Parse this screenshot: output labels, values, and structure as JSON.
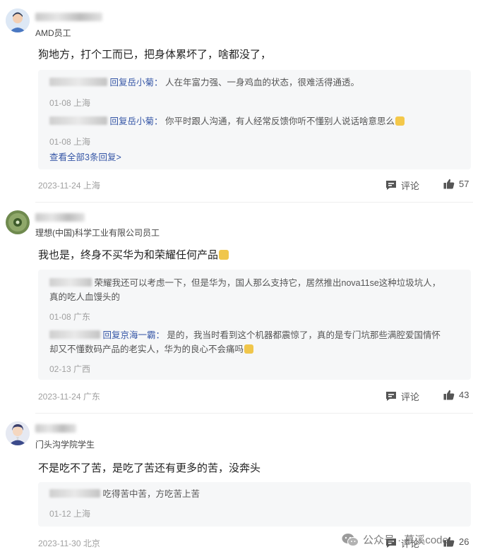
{
  "comments": [
    {
      "user_title": "AMD员工",
      "content": "狗地方，打个工而已，把身体累坏了，啥都没了，",
      "replies": [
        {
          "reply_to": "回复岳小菊：",
          "text": "人在年富力强、一身鸡血的状态，很难活得通透。",
          "meta": "01-08 上海"
        },
        {
          "reply_to": "回复岳小菊：",
          "text": "你平时跟人沟通，有人经常反馈你听不懂别人说话啥意思么",
          "meta": "01-08 上海"
        }
      ],
      "view_all": "查看全部3条回复>",
      "meta": "2023-11-24 上海",
      "comment_label": "评论",
      "likes": "57"
    },
    {
      "user_title": "理想(中国)科学工业有限公司员工",
      "content": "我也是，终身不买华为和荣耀任何产品",
      "replies": [
        {
          "text_line1": "荣耀我还可以考虑一下，但是华为，国人那么支持它，居然推出nova11se这种垃圾坑人，",
          "text_line2": "真的吃人血馒头的",
          "meta": "01-08 广东"
        },
        {
          "reply_to": "回复京海一霸：",
          "text_line1": "是的，我当时看到这个机器都震惊了，真的是专门坑那些满腔爱国情怀",
          "text_line2": "却又不懂数码产品的老实人，华为的良心不会痛吗",
          "meta": "02-13 广西"
        }
      ],
      "meta": "2023-11-24 广东",
      "comment_label": "评论",
      "likes": "43"
    },
    {
      "user_title": "门头沟学院学生",
      "content": "不是吃不了苦，是吃了苦还有更多的苦，没奔头",
      "replies": [
        {
          "text": "吃得苦中苦，方吃苦上苦",
          "meta": "01-12 上海"
        }
      ],
      "meta": "2023-11-30 北京",
      "comment_label": "评论",
      "likes": "26"
    }
  ],
  "watermark": "公众号 · 慕溪code",
  "colors": {
    "link": "#3556a6",
    "meta": "#a0a0a0",
    "reply_bg": "#f6f7f8"
  },
  "icons": [
    "comment-icon",
    "thumbs-up-icon",
    "wechat-icon"
  ]
}
